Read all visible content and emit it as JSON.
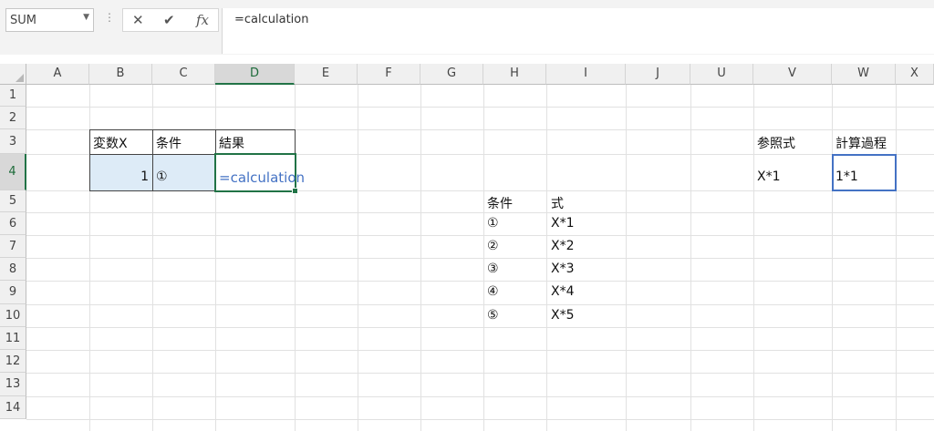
{
  "formula_bar": {
    "name_box": "SUM",
    "cancel_icon": "✕",
    "enter_icon": "✔",
    "fx_icon": "fx",
    "formula": "=calculation"
  },
  "columns": [
    "A",
    "B",
    "C",
    "D",
    "E",
    "F",
    "G",
    "H",
    "I",
    "J",
    "U",
    "V",
    "W",
    "X"
  ],
  "rows": [
    "1",
    "2",
    "3",
    "4",
    "5",
    "6",
    "7",
    "8",
    "9",
    "10",
    "11",
    "12",
    "13",
    "14"
  ],
  "cells": {
    "B3": "変数X",
    "C3": "条件",
    "D3": "結果",
    "B4": "1",
    "C4": "①",
    "D4": "=calculation",
    "H5": "条件",
    "I5": "式",
    "H6": "①",
    "I6": "X*1",
    "H7": "②",
    "I7": "X*2",
    "H8": "③",
    "I8": "X*3",
    "H9": "④",
    "I9": "X*4",
    "H10": "⑤",
    "I10": "X*5",
    "V3": "参照式",
    "W3": "計算過程",
    "V4": "X*1",
    "W4": "1*1"
  },
  "colors": {
    "accent": "#217346",
    "reference": "#4472c4",
    "fill": "#ddebf7"
  }
}
